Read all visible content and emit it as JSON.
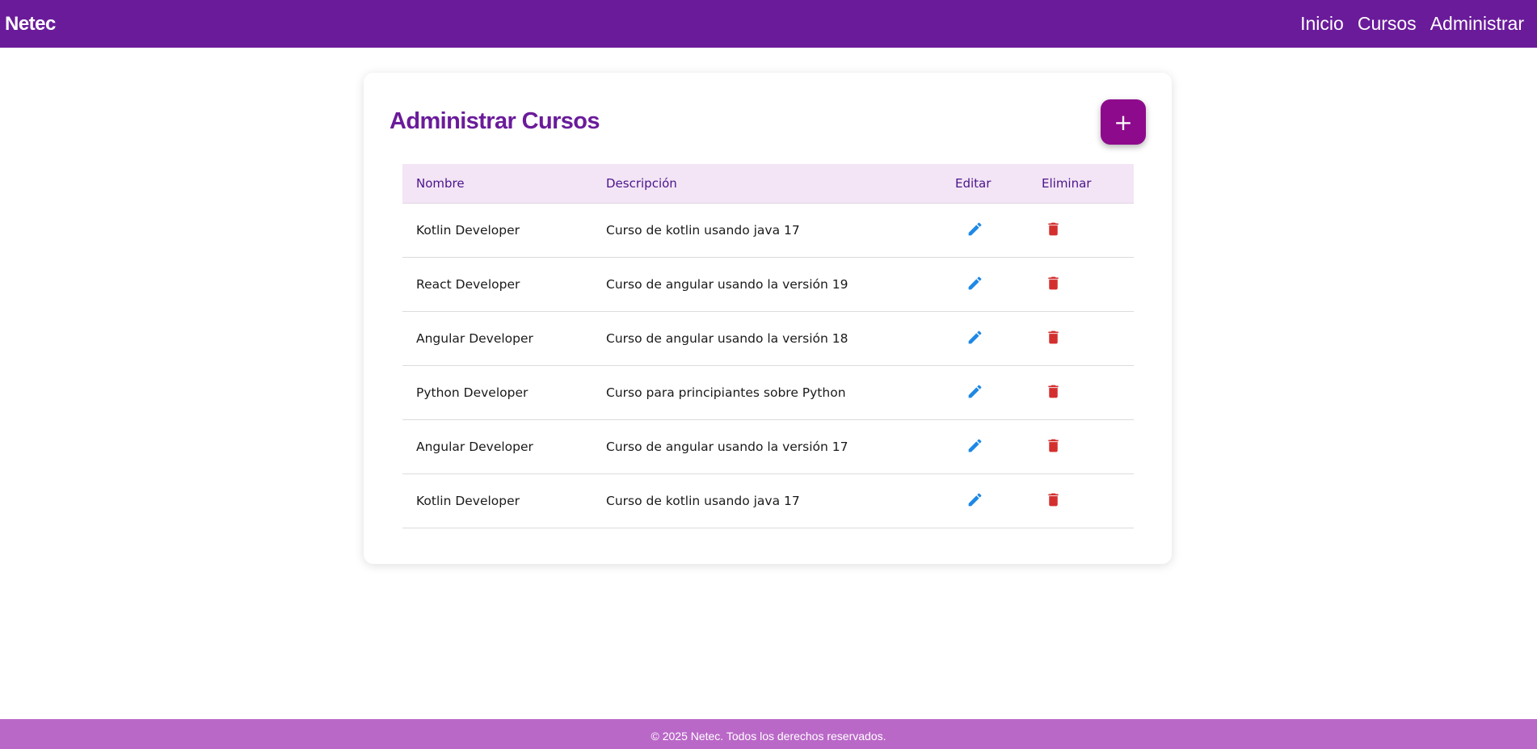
{
  "header": {
    "brand": "Netec",
    "nav": [
      "Inicio",
      "Cursos",
      "Administrar"
    ]
  },
  "main": {
    "title": "Administrar Cursos",
    "add_button_label": "+",
    "table": {
      "columns": [
        "Nombre",
        "Descripción",
        "Editar",
        "Eliminar"
      ],
      "rows": [
        {
          "name": "Kotlin Developer",
          "description": "Curso de kotlin usando java 17"
        },
        {
          "name": "React Developer",
          "description": "Curso de angular usando la versión 19"
        },
        {
          "name": "Angular Developer",
          "description": "Curso de angular usando la versión 18"
        },
        {
          "name": "Python Developer",
          "description": "Curso para principiantes sobre Python"
        },
        {
          "name": "Angular Developer",
          "description": "Curso de angular usando la versión 17"
        },
        {
          "name": "Kotlin Developer",
          "description": "Curso de kotlin usando java 17"
        }
      ]
    }
  },
  "icons": {
    "edit": "pencil-icon",
    "delete": "trash-icon"
  },
  "colors": {
    "primary": "#6a1b9a",
    "accent_button": "#8e0a8c",
    "table_header_bg": "#f3e5f5",
    "edit_icon": "#1e88e5",
    "delete_icon": "#d32f2f",
    "footer_bg": "#ba68c8"
  },
  "footer": {
    "text": "© 2025 Netec. Todos los derechos reservados."
  }
}
